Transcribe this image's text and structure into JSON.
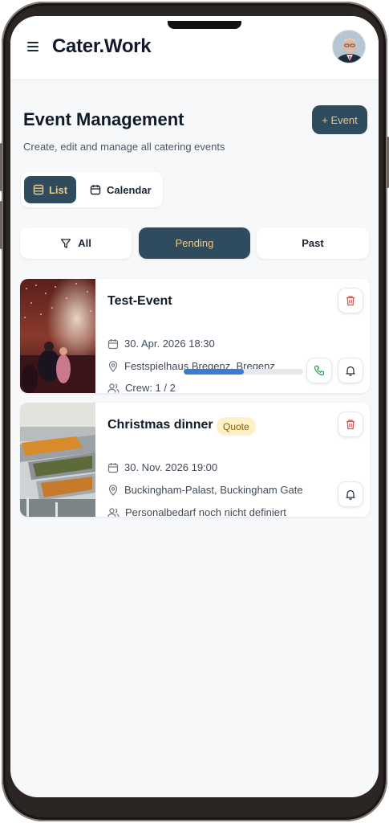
{
  "app": {
    "brand": "Cater.Work"
  },
  "page": {
    "title": "Event Management",
    "subtitle": "Create, edit and manage all catering events",
    "add_button": "+ Event"
  },
  "view_toggle": {
    "list_label": "List",
    "calendar_label": "Calendar",
    "selected": "List"
  },
  "filters": {
    "all_label": "All",
    "pending_label": "Pending",
    "past_label": "Past",
    "selected": "Pending"
  },
  "events": [
    {
      "title": "Test-Event",
      "date": "30. Apr. 2026 18:30",
      "location": "Festspielhaus Bregenz, Bregenz",
      "crew": "Crew: 1 / 2",
      "crew_fill": 0.5
    },
    {
      "title": "Christmas dinner",
      "badge": "Quote",
      "date": "30. Nov. 2026 19:00",
      "location": "Buckingham-Palast, Buckingham Gate",
      "crew": "Personalbedarf noch nicht definiert"
    }
  ],
  "colors": {
    "primary": "#2f4b5e",
    "accent": "#e9c98a",
    "progress": "#3a7bd5",
    "delete": "#d9534f",
    "phone": "#2e9e4f",
    "badge_bg": "#fdf0c6",
    "badge_text": "#8a5a0b"
  },
  "icons": {
    "menu": "hamburger-menu-icon",
    "list": "list-icon",
    "calendar": "calendar-icon",
    "filter": "filter-icon",
    "date": "calendar-icon",
    "location": "map-pin-icon",
    "crew": "users-icon",
    "delete": "trash-icon",
    "call": "phone-icon",
    "notify": "bell-icon"
  }
}
